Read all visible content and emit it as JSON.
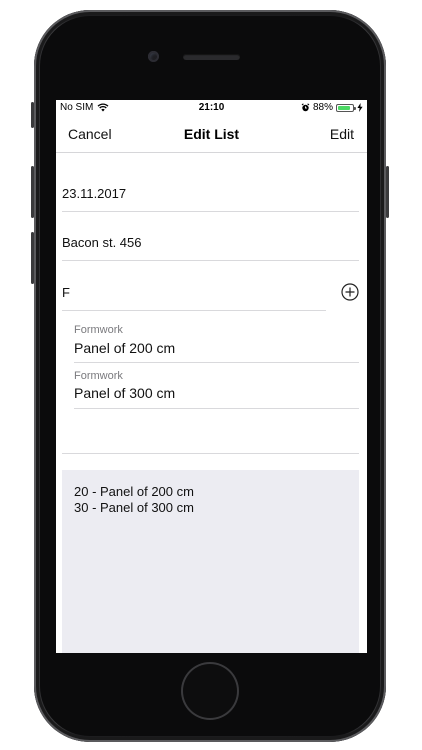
{
  "status_bar": {
    "carrier": "No SIM",
    "time": "21:10",
    "battery_percent": "88%",
    "battery_level": 0.88,
    "wifi_icon": "wifi-icon",
    "alarm_icon": "alarm-icon",
    "charging_icon": "charging-bolt-icon",
    "battery_color": "#4cd964"
  },
  "nav": {
    "cancel_label": "Cancel",
    "title": "Edit List",
    "edit_label": "Edit"
  },
  "form": {
    "date_value": "23.11.2017",
    "address_value": "Bacon st. 456",
    "search_value": "F",
    "add_icon": "plus-circle-icon"
  },
  "items": [
    {
      "category": "Formwork",
      "name": "Panel of 200 cm"
    },
    {
      "category": "Formwork",
      "name": "Panel of 300 cm"
    }
  ],
  "summary": {
    "lines": [
      "20 - Panel of 200 cm",
      "30 - Panel of 300 cm"
    ],
    "background": "#ececf2"
  }
}
